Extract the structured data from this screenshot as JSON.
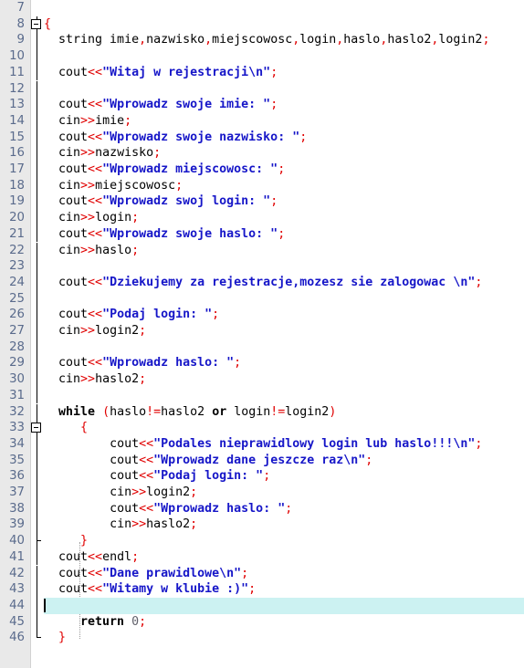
{
  "editor": {
    "language": "cpp",
    "first_line_number": 7,
    "current_line_number": 44,
    "colors": {
      "background": "#ffffff",
      "gutter": "#e9e9e9",
      "line_number": "#5a6b8c",
      "string": "#1616c8",
      "operator": "#e00000",
      "keyword": "#000000",
      "number": "#61616b",
      "current_line_highlight": "#ccf2f2"
    },
    "fold_markers": {
      "open_lines": [
        8,
        33
      ],
      "close_lines": [
        40,
        46
      ],
      "glyph": "minus-box"
    }
  },
  "lines": [
    {
      "n": 7,
      "tokens": []
    },
    {
      "n": 8,
      "fold": "open",
      "tokens": [
        {
          "c": "op",
          "t": "{"
        }
      ]
    },
    {
      "n": 9,
      "tokens": [
        {
          "c": "pl",
          "t": "  "
        },
        {
          "c": "id",
          "t": "string imie"
        },
        {
          "c": "op",
          "t": ","
        },
        {
          "c": "id",
          "t": "nazwisko"
        },
        {
          "c": "op",
          "t": ","
        },
        {
          "c": "id",
          "t": "miejscowosc"
        },
        {
          "c": "op",
          "t": ","
        },
        {
          "c": "id",
          "t": "login"
        },
        {
          "c": "op",
          "t": ","
        },
        {
          "c": "id",
          "t": "haslo"
        },
        {
          "c": "op",
          "t": ","
        },
        {
          "c": "id",
          "t": "haslo2"
        },
        {
          "c": "op",
          "t": ","
        },
        {
          "c": "id",
          "t": "login2"
        },
        {
          "c": "op",
          "t": ";"
        }
      ]
    },
    {
      "n": 10,
      "tokens": []
    },
    {
      "n": 11,
      "tokens": [
        {
          "c": "pl",
          "t": "  "
        },
        {
          "c": "id",
          "t": "cout"
        },
        {
          "c": "op",
          "t": "<<"
        },
        {
          "c": "str",
          "t": "\"Witaj w rejestracji\\n\""
        },
        {
          "c": "op",
          "t": ";"
        }
      ]
    },
    {
      "n": 12,
      "tokens": []
    },
    {
      "n": 13,
      "tokens": [
        {
          "c": "pl",
          "t": "  "
        },
        {
          "c": "id",
          "t": "cout"
        },
        {
          "c": "op",
          "t": "<<"
        },
        {
          "c": "str",
          "t": "\"Wprowadz swoje imie: \""
        },
        {
          "c": "op",
          "t": ";"
        }
      ]
    },
    {
      "n": 14,
      "tokens": [
        {
          "c": "pl",
          "t": "  "
        },
        {
          "c": "id",
          "t": "cin"
        },
        {
          "c": "op",
          "t": ">>"
        },
        {
          "c": "id",
          "t": "imie"
        },
        {
          "c": "op",
          "t": ";"
        }
      ]
    },
    {
      "n": 15,
      "tokens": [
        {
          "c": "pl",
          "t": "  "
        },
        {
          "c": "id",
          "t": "cout"
        },
        {
          "c": "op",
          "t": "<<"
        },
        {
          "c": "str",
          "t": "\"Wprowadz swoje nazwisko: \""
        },
        {
          "c": "op",
          "t": ";"
        }
      ]
    },
    {
      "n": 16,
      "tokens": [
        {
          "c": "pl",
          "t": "  "
        },
        {
          "c": "id",
          "t": "cin"
        },
        {
          "c": "op",
          "t": ">>"
        },
        {
          "c": "id",
          "t": "nazwisko"
        },
        {
          "c": "op",
          "t": ";"
        }
      ]
    },
    {
      "n": 17,
      "tokens": [
        {
          "c": "pl",
          "t": "  "
        },
        {
          "c": "id",
          "t": "cout"
        },
        {
          "c": "op",
          "t": "<<"
        },
        {
          "c": "str",
          "t": "\"Wprowadz miejscowosc: \""
        },
        {
          "c": "op",
          "t": ";"
        }
      ]
    },
    {
      "n": 18,
      "tokens": [
        {
          "c": "pl",
          "t": "  "
        },
        {
          "c": "id",
          "t": "cin"
        },
        {
          "c": "op",
          "t": ">>"
        },
        {
          "c": "id",
          "t": "miejscowosc"
        },
        {
          "c": "op",
          "t": ";"
        }
      ]
    },
    {
      "n": 19,
      "tokens": [
        {
          "c": "pl",
          "t": "  "
        },
        {
          "c": "id",
          "t": "cout"
        },
        {
          "c": "op",
          "t": "<<"
        },
        {
          "c": "str",
          "t": "\"Wprowadz swoj login: \""
        },
        {
          "c": "op",
          "t": ";"
        }
      ]
    },
    {
      "n": 20,
      "tokens": [
        {
          "c": "pl",
          "t": "  "
        },
        {
          "c": "id",
          "t": "cin"
        },
        {
          "c": "op",
          "t": ">>"
        },
        {
          "c": "id",
          "t": "login"
        },
        {
          "c": "op",
          "t": ";"
        }
      ]
    },
    {
      "n": 21,
      "tokens": [
        {
          "c": "pl",
          "t": "  "
        },
        {
          "c": "id",
          "t": "cout"
        },
        {
          "c": "op",
          "t": "<<"
        },
        {
          "c": "str",
          "t": "\"Wprowadz swoje haslo: \""
        },
        {
          "c": "op",
          "t": ";"
        }
      ]
    },
    {
      "n": 22,
      "tokens": [
        {
          "c": "pl",
          "t": "  "
        },
        {
          "c": "id",
          "t": "cin"
        },
        {
          "c": "op",
          "t": ">>"
        },
        {
          "c": "id",
          "t": "haslo"
        },
        {
          "c": "op",
          "t": ";"
        }
      ]
    },
    {
      "n": 23,
      "tokens": []
    },
    {
      "n": 24,
      "tokens": [
        {
          "c": "pl",
          "t": "  "
        },
        {
          "c": "id",
          "t": "cout"
        },
        {
          "c": "op",
          "t": "<<"
        },
        {
          "c": "str",
          "t": "\"Dziekujemy za rejestracje,mozesz sie zalogowac \\n\""
        },
        {
          "c": "op",
          "t": ";"
        }
      ]
    },
    {
      "n": 25,
      "tokens": []
    },
    {
      "n": 26,
      "tokens": [
        {
          "c": "pl",
          "t": "  "
        },
        {
          "c": "id",
          "t": "cout"
        },
        {
          "c": "op",
          "t": "<<"
        },
        {
          "c": "str",
          "t": "\"Podaj login: \""
        },
        {
          "c": "op",
          "t": ";"
        }
      ]
    },
    {
      "n": 27,
      "tokens": [
        {
          "c": "pl",
          "t": "  "
        },
        {
          "c": "id",
          "t": "cin"
        },
        {
          "c": "op",
          "t": ">>"
        },
        {
          "c": "id",
          "t": "login2"
        },
        {
          "c": "op",
          "t": ";"
        }
      ]
    },
    {
      "n": 28,
      "tokens": []
    },
    {
      "n": 29,
      "tokens": [
        {
          "c": "pl",
          "t": "  "
        },
        {
          "c": "id",
          "t": "cout"
        },
        {
          "c": "op",
          "t": "<<"
        },
        {
          "c": "str",
          "t": "\"Wprowadz haslo: \""
        },
        {
          "c": "op",
          "t": ";"
        }
      ]
    },
    {
      "n": 30,
      "tokens": [
        {
          "c": "pl",
          "t": "  "
        },
        {
          "c": "id",
          "t": "cin"
        },
        {
          "c": "op",
          "t": ">>"
        },
        {
          "c": "id",
          "t": "haslo2"
        },
        {
          "c": "op",
          "t": ";"
        }
      ]
    },
    {
      "n": 31,
      "tokens": []
    },
    {
      "n": 32,
      "tokens": [
        {
          "c": "pl",
          "t": "  "
        },
        {
          "c": "kw",
          "t": "while"
        },
        {
          "c": "pl",
          "t": " "
        },
        {
          "c": "op",
          "t": "("
        },
        {
          "c": "id",
          "t": "haslo"
        },
        {
          "c": "op",
          "t": "!="
        },
        {
          "c": "id",
          "t": "haslo2"
        },
        {
          "c": "pl",
          "t": " "
        },
        {
          "c": "kw",
          "t": "or"
        },
        {
          "c": "pl",
          "t": " "
        },
        {
          "c": "id",
          "t": "login"
        },
        {
          "c": "op",
          "t": "!="
        },
        {
          "c": "id",
          "t": "login2"
        },
        {
          "c": "op",
          "t": ")"
        }
      ]
    },
    {
      "n": 33,
      "fold": "open",
      "tokens": [
        {
          "c": "pl",
          "t": "     "
        },
        {
          "c": "op",
          "t": "{"
        }
      ]
    },
    {
      "n": 34,
      "tokens": [
        {
          "c": "pl",
          "t": "         "
        },
        {
          "c": "id",
          "t": "cout"
        },
        {
          "c": "op",
          "t": "<<"
        },
        {
          "c": "str",
          "t": "\"Podales nieprawidlowy login lub haslo!!!\\n\""
        },
        {
          "c": "op",
          "t": ";"
        }
      ]
    },
    {
      "n": 35,
      "tokens": [
        {
          "c": "pl",
          "t": "         "
        },
        {
          "c": "id",
          "t": "cout"
        },
        {
          "c": "op",
          "t": "<<"
        },
        {
          "c": "str",
          "t": "\"Wprowadz dane jeszcze raz\\n\""
        },
        {
          "c": "op",
          "t": ";"
        }
      ]
    },
    {
      "n": 36,
      "tokens": [
        {
          "c": "pl",
          "t": "         "
        },
        {
          "c": "id",
          "t": "cout"
        },
        {
          "c": "op",
          "t": "<<"
        },
        {
          "c": "str",
          "t": "\"Podaj login: \""
        },
        {
          "c": "op",
          "t": ";"
        }
      ]
    },
    {
      "n": 37,
      "tokens": [
        {
          "c": "pl",
          "t": "         "
        },
        {
          "c": "id",
          "t": "cin"
        },
        {
          "c": "op",
          "t": ">>"
        },
        {
          "c": "id",
          "t": "login2"
        },
        {
          "c": "op",
          "t": ";"
        }
      ]
    },
    {
      "n": 38,
      "tokens": [
        {
          "c": "pl",
          "t": "         "
        },
        {
          "c": "id",
          "t": "cout"
        },
        {
          "c": "op",
          "t": "<<"
        },
        {
          "c": "str",
          "t": "\"Wprowadz haslo: \""
        },
        {
          "c": "op",
          "t": ";"
        }
      ]
    },
    {
      "n": 39,
      "tokens": [
        {
          "c": "pl",
          "t": "         "
        },
        {
          "c": "id",
          "t": "cin"
        },
        {
          "c": "op",
          "t": ">>"
        },
        {
          "c": "id",
          "t": "haslo2"
        },
        {
          "c": "op",
          "t": ";"
        }
      ]
    },
    {
      "n": 40,
      "fold": "tick",
      "tokens": [
        {
          "c": "pl",
          "t": "     "
        },
        {
          "c": "op",
          "t": "}"
        }
      ]
    },
    {
      "n": 41,
      "tokens": [
        {
          "c": "pl",
          "t": "  "
        },
        {
          "c": "id",
          "t": "cout"
        },
        {
          "c": "op",
          "t": "<<"
        },
        {
          "c": "id",
          "t": "endl"
        },
        {
          "c": "op",
          "t": ";"
        }
      ]
    },
    {
      "n": 42,
      "tokens": [
        {
          "c": "pl",
          "t": "  "
        },
        {
          "c": "id",
          "t": "cout"
        },
        {
          "c": "op",
          "t": "<<"
        },
        {
          "c": "str",
          "t": "\"Dane prawidlowe\\n\""
        },
        {
          "c": "op",
          "t": ";"
        }
      ]
    },
    {
      "n": 43,
      "tokens": [
        {
          "c": "pl",
          "t": "  "
        },
        {
          "c": "id",
          "t": "cout"
        },
        {
          "c": "op",
          "t": "<<"
        },
        {
          "c": "str",
          "t": "\"Witamy w klubie :)\""
        },
        {
          "c": "op",
          "t": ";"
        }
      ]
    },
    {
      "n": 44,
      "current": true,
      "tokens": []
    },
    {
      "n": 45,
      "tokens": [
        {
          "c": "pl",
          "t": "     "
        },
        {
          "c": "kw",
          "t": "return"
        },
        {
          "c": "pl",
          "t": " "
        },
        {
          "c": "num",
          "t": "0"
        },
        {
          "c": "op",
          "t": ";"
        }
      ]
    },
    {
      "n": 46,
      "fold": "close",
      "tokens": [
        {
          "c": "pl",
          "t": "  "
        },
        {
          "c": "op",
          "t": "}"
        }
      ]
    }
  ]
}
